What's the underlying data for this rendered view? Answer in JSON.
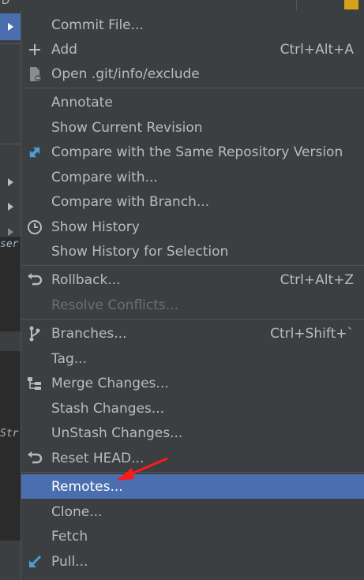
{
  "background": {
    "left_letter": "D",
    "code_fragments": [
      "ser",
      "Str"
    ]
  },
  "menu": {
    "items": [
      {
        "label": "Commit File...",
        "shortcut": "",
        "icon": ""
      },
      {
        "label": "Add",
        "shortcut": "Ctrl+Alt+A",
        "icon": "plus-icon"
      },
      {
        "label": "Open .git/info/exclude",
        "shortcut": "",
        "icon": "git-file-icon"
      },
      {
        "label": "Annotate",
        "shortcut": "",
        "icon": ""
      },
      {
        "label": "Show Current Revision",
        "shortcut": "",
        "icon": ""
      },
      {
        "label": "Compare with the Same Repository Version",
        "shortcut": "",
        "icon": "compare-icon"
      },
      {
        "label": "Compare with...",
        "shortcut": "",
        "icon": ""
      },
      {
        "label": "Compare with Branch...",
        "shortcut": "",
        "icon": ""
      },
      {
        "label": "Show History",
        "shortcut": "",
        "icon": "clock-icon"
      },
      {
        "label": "Show History for Selection",
        "shortcut": "",
        "icon": ""
      },
      {
        "label": "Rollback...",
        "shortcut": "Ctrl+Alt+Z",
        "icon": "undo-icon"
      },
      {
        "label": "Resolve Conflicts...",
        "shortcut": "",
        "icon": ""
      },
      {
        "label": "Branches...",
        "shortcut": "Ctrl+Shift+`",
        "icon": "branch-icon"
      },
      {
        "label": "Tag...",
        "shortcut": "",
        "icon": ""
      },
      {
        "label": "Merge Changes...",
        "shortcut": "",
        "icon": "merge-icon"
      },
      {
        "label": "Stash Changes...",
        "shortcut": "",
        "icon": ""
      },
      {
        "label": "UnStash Changes...",
        "shortcut": "",
        "icon": ""
      },
      {
        "label": "Reset HEAD...",
        "shortcut": "",
        "icon": "undo-icon"
      },
      {
        "label": "Remotes...",
        "shortcut": "",
        "icon": ""
      },
      {
        "label": "Clone...",
        "shortcut": "",
        "icon": ""
      },
      {
        "label": "Fetch",
        "shortcut": "",
        "icon": ""
      },
      {
        "label": "Pull...",
        "shortcut": "",
        "icon": "pull-icon"
      }
    ],
    "selected": "Remotes...",
    "disabled": [
      "Resolve Conflicts..."
    ]
  },
  "colors": {
    "menu_bg": "#3c3f41",
    "selection": "#4b6eaf",
    "annotation_arrow": "#ff1a1a"
  }
}
